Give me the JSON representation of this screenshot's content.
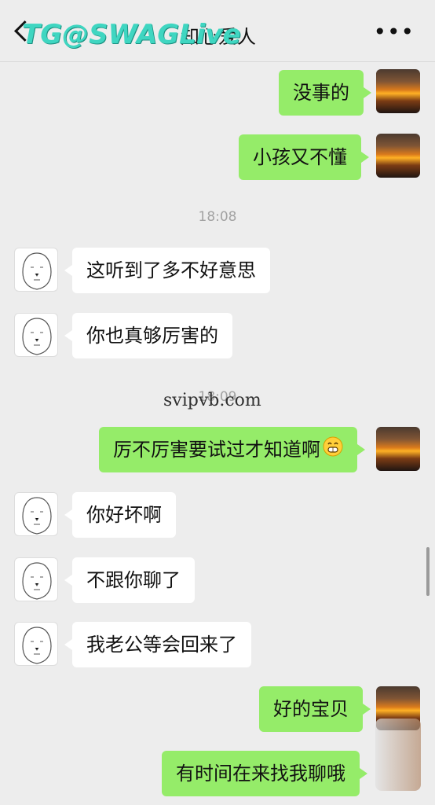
{
  "header": {
    "title": "知心爱人",
    "more_label": "•••",
    "watermark": "TG@SWAGLive"
  },
  "timestamps": {
    "t1": "18:08",
    "t2": "18:09"
  },
  "watermark_mid": "svipvb.com",
  "messages": [
    {
      "side": "right",
      "text": "没事的"
    },
    {
      "side": "right",
      "text": "小孩又不懂"
    },
    {
      "side": "left",
      "text": "这听到了多不好意思"
    },
    {
      "side": "left",
      "text": "你也真够厉害的"
    },
    {
      "side": "right",
      "text": "厉不厉害要试过才知道啊"
    },
    {
      "side": "left",
      "text": "你好坏啊"
    },
    {
      "side": "left",
      "text": "不跟你聊了"
    },
    {
      "side": "left",
      "text": "我老公等会回来了"
    },
    {
      "side": "right",
      "text": "好的宝贝"
    },
    {
      "side": "right",
      "text": "有时间在来找我聊哦"
    }
  ],
  "colors": {
    "background": "#ededed",
    "bubble_sent": "#95ec69",
    "bubble_received": "#ffffff"
  },
  "icons": {
    "back": "chevron-left-icon",
    "more": "more-dots-icon",
    "grin": "grin-emoji-icon"
  }
}
